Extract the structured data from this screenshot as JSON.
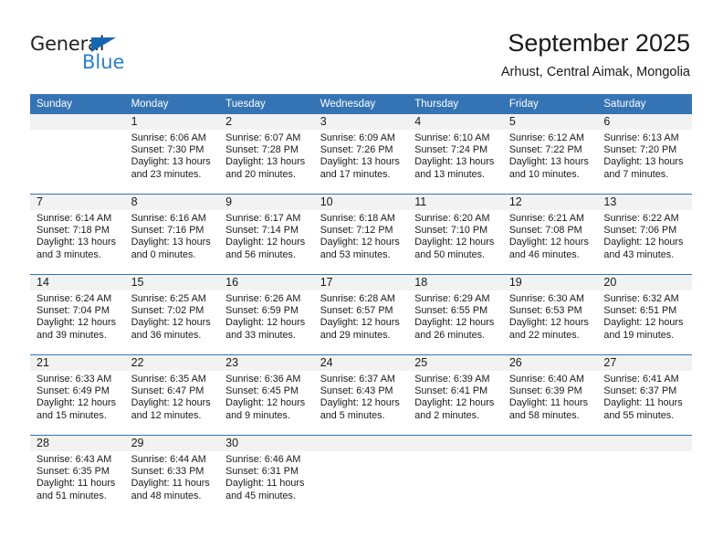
{
  "logo": {
    "word_top": "General",
    "word_bottom": "Blue",
    "triangle_color": "#1567b3",
    "blue_color": "#2a7fc9"
  },
  "header": {
    "title": "September 2025",
    "subtitle": "Arhust, Central Aimak, Mongolia",
    "accent_color": "#3574b4"
  },
  "calendar": {
    "weekday_headers": [
      "Sunday",
      "Monday",
      "Tuesday",
      "Wednesday",
      "Thursday",
      "Friday",
      "Saturday"
    ],
    "weeks": [
      [
        {
          "day": "",
          "lines": []
        },
        {
          "day": "1",
          "lines": [
            "Sunrise: 6:06 AM",
            "Sunset: 7:30 PM",
            "Daylight: 13 hours",
            "and 23 minutes."
          ]
        },
        {
          "day": "2",
          "lines": [
            "Sunrise: 6:07 AM",
            "Sunset: 7:28 PM",
            "Daylight: 13 hours",
            "and 20 minutes."
          ]
        },
        {
          "day": "3",
          "lines": [
            "Sunrise: 6:09 AM",
            "Sunset: 7:26 PM",
            "Daylight: 13 hours",
            "and 17 minutes."
          ]
        },
        {
          "day": "4",
          "lines": [
            "Sunrise: 6:10 AM",
            "Sunset: 7:24 PM",
            "Daylight: 13 hours",
            "and 13 minutes."
          ]
        },
        {
          "day": "5",
          "lines": [
            "Sunrise: 6:12 AM",
            "Sunset: 7:22 PM",
            "Daylight: 13 hours",
            "and 10 minutes."
          ]
        },
        {
          "day": "6",
          "lines": [
            "Sunrise: 6:13 AM",
            "Sunset: 7:20 PM",
            "Daylight: 13 hours",
            "and 7 minutes."
          ]
        }
      ],
      [
        {
          "day": "7",
          "lines": [
            "Sunrise: 6:14 AM",
            "Sunset: 7:18 PM",
            "Daylight: 13 hours",
            "and 3 minutes."
          ]
        },
        {
          "day": "8",
          "lines": [
            "Sunrise: 6:16 AM",
            "Sunset: 7:16 PM",
            "Daylight: 13 hours",
            "and 0 minutes."
          ]
        },
        {
          "day": "9",
          "lines": [
            "Sunrise: 6:17 AM",
            "Sunset: 7:14 PM",
            "Daylight: 12 hours",
            "and 56 minutes."
          ]
        },
        {
          "day": "10",
          "lines": [
            "Sunrise: 6:18 AM",
            "Sunset: 7:12 PM",
            "Daylight: 12 hours",
            "and 53 minutes."
          ]
        },
        {
          "day": "11",
          "lines": [
            "Sunrise: 6:20 AM",
            "Sunset: 7:10 PM",
            "Daylight: 12 hours",
            "and 50 minutes."
          ]
        },
        {
          "day": "12",
          "lines": [
            "Sunrise: 6:21 AM",
            "Sunset: 7:08 PM",
            "Daylight: 12 hours",
            "and 46 minutes."
          ]
        },
        {
          "day": "13",
          "lines": [
            "Sunrise: 6:22 AM",
            "Sunset: 7:06 PM",
            "Daylight: 12 hours",
            "and 43 minutes."
          ]
        }
      ],
      [
        {
          "day": "14",
          "lines": [
            "Sunrise: 6:24 AM",
            "Sunset: 7:04 PM",
            "Daylight: 12 hours",
            "and 39 minutes."
          ]
        },
        {
          "day": "15",
          "lines": [
            "Sunrise: 6:25 AM",
            "Sunset: 7:02 PM",
            "Daylight: 12 hours",
            "and 36 minutes."
          ]
        },
        {
          "day": "16",
          "lines": [
            "Sunrise: 6:26 AM",
            "Sunset: 6:59 PM",
            "Daylight: 12 hours",
            "and 33 minutes."
          ]
        },
        {
          "day": "17",
          "lines": [
            "Sunrise: 6:28 AM",
            "Sunset: 6:57 PM",
            "Daylight: 12 hours",
            "and 29 minutes."
          ]
        },
        {
          "day": "18",
          "lines": [
            "Sunrise: 6:29 AM",
            "Sunset: 6:55 PM",
            "Daylight: 12 hours",
            "and 26 minutes."
          ]
        },
        {
          "day": "19",
          "lines": [
            "Sunrise: 6:30 AM",
            "Sunset: 6:53 PM",
            "Daylight: 12 hours",
            "and 22 minutes."
          ]
        },
        {
          "day": "20",
          "lines": [
            "Sunrise: 6:32 AM",
            "Sunset: 6:51 PM",
            "Daylight: 12 hours",
            "and 19 minutes."
          ]
        }
      ],
      [
        {
          "day": "21",
          "lines": [
            "Sunrise: 6:33 AM",
            "Sunset: 6:49 PM",
            "Daylight: 12 hours",
            "and 15 minutes."
          ]
        },
        {
          "day": "22",
          "lines": [
            "Sunrise: 6:35 AM",
            "Sunset: 6:47 PM",
            "Daylight: 12 hours",
            "and 12 minutes."
          ]
        },
        {
          "day": "23",
          "lines": [
            "Sunrise: 6:36 AM",
            "Sunset: 6:45 PM",
            "Daylight: 12 hours",
            "and 9 minutes."
          ]
        },
        {
          "day": "24",
          "lines": [
            "Sunrise: 6:37 AM",
            "Sunset: 6:43 PM",
            "Daylight: 12 hours",
            "and 5 minutes."
          ]
        },
        {
          "day": "25",
          "lines": [
            "Sunrise: 6:39 AM",
            "Sunset: 6:41 PM",
            "Daylight: 12 hours",
            "and 2 minutes."
          ]
        },
        {
          "day": "26",
          "lines": [
            "Sunrise: 6:40 AM",
            "Sunset: 6:39 PM",
            "Daylight: 11 hours",
            "and 58 minutes."
          ]
        },
        {
          "day": "27",
          "lines": [
            "Sunrise: 6:41 AM",
            "Sunset: 6:37 PM",
            "Daylight: 11 hours",
            "and 55 minutes."
          ]
        }
      ],
      [
        {
          "day": "28",
          "lines": [
            "Sunrise: 6:43 AM",
            "Sunset: 6:35 PM",
            "Daylight: 11 hours",
            "and 51 minutes."
          ]
        },
        {
          "day": "29",
          "lines": [
            "Sunrise: 6:44 AM",
            "Sunset: 6:33 PM",
            "Daylight: 11 hours",
            "and 48 minutes."
          ]
        },
        {
          "day": "30",
          "lines": [
            "Sunrise: 6:46 AM",
            "Sunset: 6:31 PM",
            "Daylight: 11 hours",
            "and 45 minutes."
          ]
        },
        {
          "day": "",
          "lines": []
        },
        {
          "day": "",
          "lines": []
        },
        {
          "day": "",
          "lines": []
        },
        {
          "day": "",
          "lines": []
        }
      ]
    ]
  }
}
